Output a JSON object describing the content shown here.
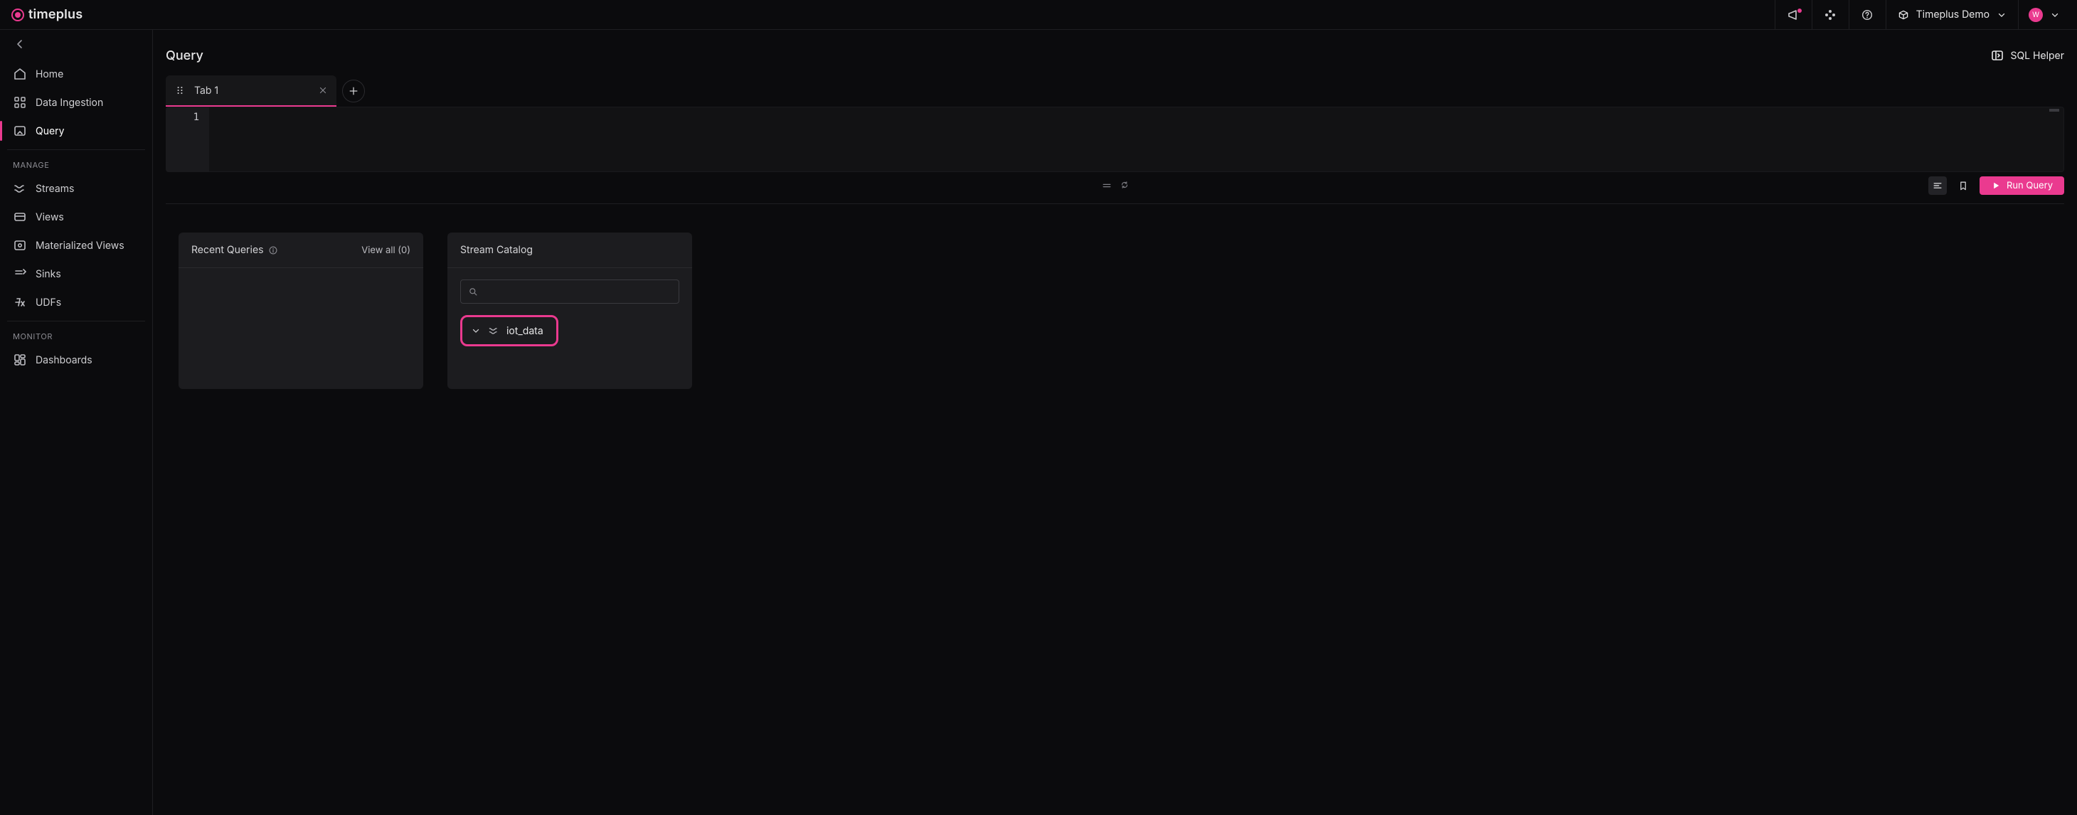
{
  "brand": {
    "name": "timeplus"
  },
  "header": {
    "workspace_label": "Timeplus Demo",
    "user_initial": "W"
  },
  "sidebar": {
    "items": [
      {
        "key": "home",
        "label": "Home"
      },
      {
        "key": "ingestion",
        "label": "Data Ingestion"
      },
      {
        "key": "query",
        "label": "Query",
        "active": true
      }
    ],
    "sections": [
      {
        "key": "manage",
        "label": "MANAGE",
        "items": [
          {
            "key": "streams",
            "label": "Streams"
          },
          {
            "key": "views",
            "label": "Views"
          },
          {
            "key": "matviews",
            "label": "Materialized Views"
          },
          {
            "key": "sinks",
            "label": "Sinks"
          },
          {
            "key": "udfs",
            "label": "UDFs"
          }
        ]
      },
      {
        "key": "monitor",
        "label": "MONITOR",
        "items": [
          {
            "key": "dashboards",
            "label": "Dashboards"
          }
        ]
      }
    ]
  },
  "page": {
    "title": "Query",
    "sql_helper_label": "SQL Helper"
  },
  "tabs": {
    "items": [
      {
        "label": "Tab 1"
      }
    ]
  },
  "editor": {
    "line_numbers": [
      "1"
    ],
    "run_label": "Run Query"
  },
  "panels": {
    "recent": {
      "title": "Recent Queries",
      "view_all_label": "View all (0)"
    },
    "catalog": {
      "title": "Stream Catalog",
      "search_value": "",
      "streams": [
        {
          "name": "iot_data"
        }
      ]
    }
  }
}
